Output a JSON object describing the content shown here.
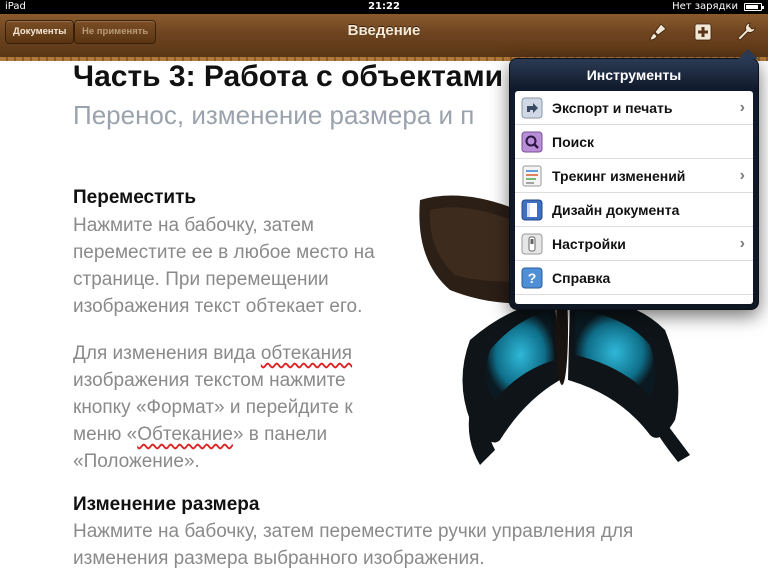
{
  "status_bar": {
    "device": "iPad",
    "time": "21:22",
    "battery_text": "Нет зарядки"
  },
  "toolbar": {
    "documents_label": "Документы",
    "undo_label": "Не применять",
    "title": "Введение",
    "icons": [
      "paintbrush-icon",
      "plus-icon",
      "wrench-icon"
    ]
  },
  "document": {
    "title": "Часть 3: Работа с объектами",
    "subtitle": "Перенос, изменение размера и п",
    "sections": [
      {
        "heading": "Переместить",
        "paragraphs": [
          "Нажмите на бабочку, затем переместите ее в любое место на странице. При перемещении изображения текст обтекает его.",
          "Для изменения вида обтекания изображения текстом нажмите кнопку «Формат» и перейдите к меню «Обтекание» в панели «Положение»."
        ]
      },
      {
        "heading": "Изменение размера",
        "paragraphs": [
          "Нажмите на бабочку, затем переместите ручки управления для изменения размера выбранного изображения."
        ]
      }
    ]
  },
  "popover": {
    "title": "Инструменты",
    "items": [
      {
        "label": "Экспорт и печать",
        "icon": "share-icon",
        "has_chevron": true
      },
      {
        "label": "Поиск",
        "icon": "search-icon",
        "has_chevron": false
      },
      {
        "label": "Трекинг изменений",
        "icon": "track-changes-icon",
        "has_chevron": true
      },
      {
        "label": "Дизайн документа",
        "icon": "document-design-icon",
        "has_chevron": false
      },
      {
        "label": "Настройки",
        "icon": "settings-icon",
        "has_chevron": true
      },
      {
        "label": "Справка",
        "icon": "help-icon",
        "has_chevron": false
      }
    ]
  }
}
